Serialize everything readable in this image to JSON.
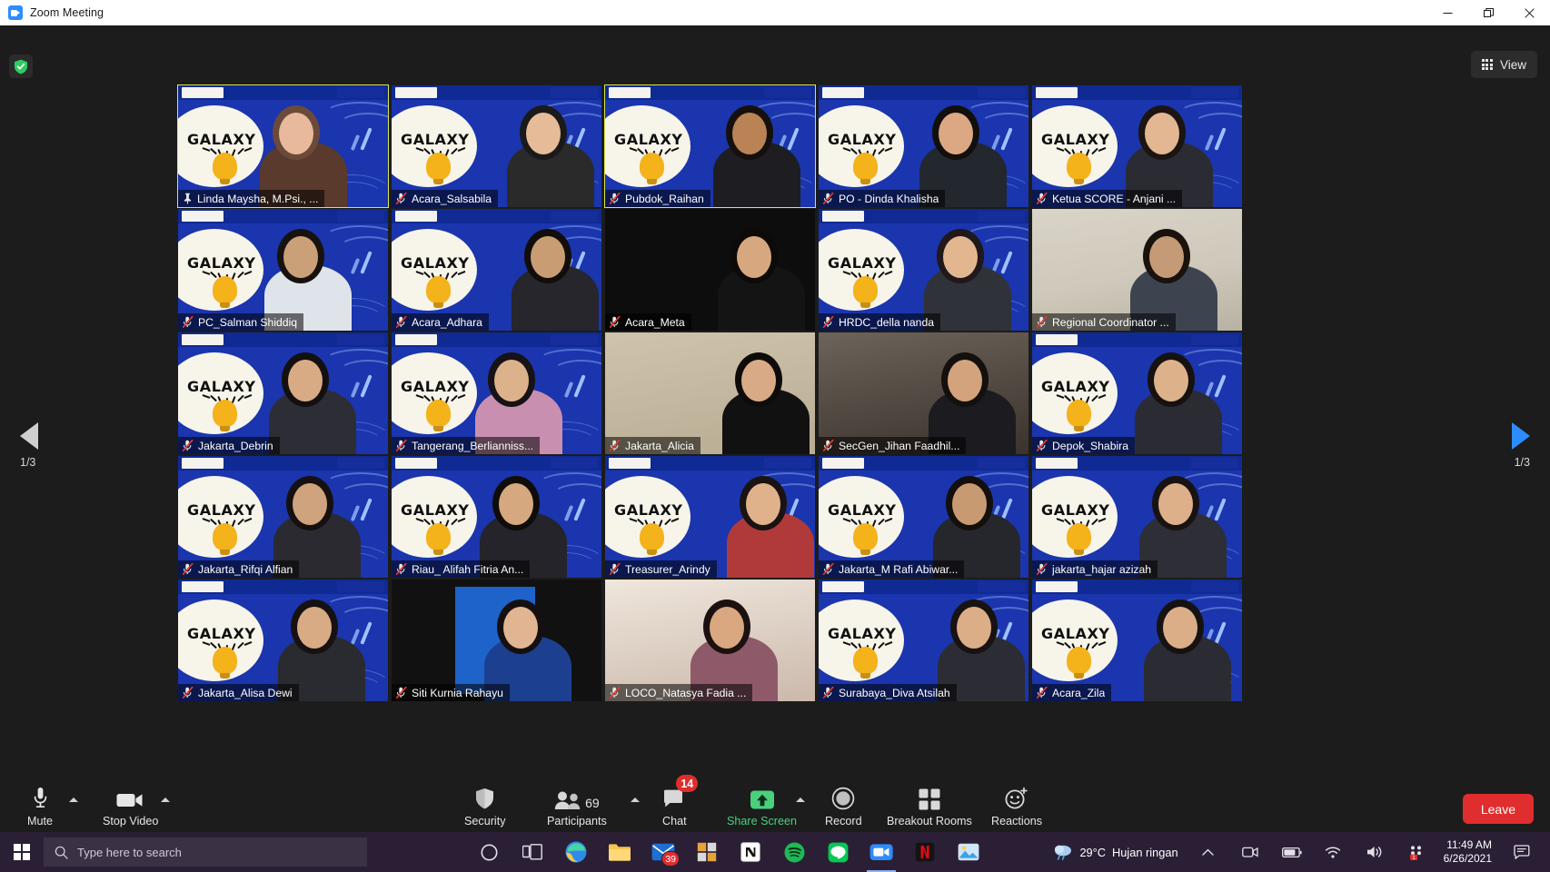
{
  "window": {
    "title": "Zoom Meeting",
    "app_icon": "zoom-icon",
    "minimize_label": "Minimize",
    "restore_label": "Restore",
    "close_label": "Close"
  },
  "topbar": {
    "encryption_icon": "green-shield-check-icon",
    "view_label": "View",
    "view_icon": "grid-icon"
  },
  "gallery": {
    "virtual_bg_text": "GALAXY",
    "page_left": "1/3",
    "page_right": "1/3",
    "prev_icon": "triangle-left-icon",
    "next_icon": "triangle-right-icon",
    "tiles": [
      {
        "name": "Linda Maysha, M.Psi., ...",
        "mic": "muted-pin",
        "active": true,
        "bg": "virtual",
        "skin": "#e8b99a",
        "hair": "#6b4a3a",
        "cloth": "#5a3a2c"
      },
      {
        "name": "Acara_Salsabila",
        "mic": "muted",
        "active": false,
        "bg": "virtual",
        "skin": "#e6bb97",
        "hair": "#1a1a1a",
        "cloth": "#2a2a2a"
      },
      {
        "name": "Pubdok_Raihan",
        "mic": "muted",
        "active": true,
        "bg": "virtual",
        "skin": "#b98355",
        "hair": "#15100c",
        "cloth": "#1d1d22"
      },
      {
        "name": "PO - Dinda Khalisha",
        "mic": "muted",
        "active": false,
        "bg": "virtual",
        "skin": "#dba883",
        "hair": "#120f0d",
        "cloth": "#23272e"
      },
      {
        "name": "Ketua SCORE - Anjani ...",
        "mic": "muted",
        "active": false,
        "bg": "virtual",
        "skin": "#e3b792",
        "hair": "#1b1410",
        "cloth": "#2b2b33"
      },
      {
        "name": "PC_Salman Shiddiq",
        "mic": "muted",
        "active": false,
        "bg": "virtual",
        "skin": "#caa078",
        "hair": "#17120e",
        "cloth": "#dfe3ea"
      },
      {
        "name": "Acara_Adhara",
        "mic": "muted",
        "active": false,
        "bg": "virtual",
        "skin": "#c99d74",
        "hair": "#120d0a",
        "cloth": "#26262c"
      },
      {
        "name": "Acara_Meta",
        "mic": "muted",
        "active": false,
        "bg": "dark",
        "skin": "#d7a87f",
        "hair": "#0d0a08",
        "cloth": "#141414"
      },
      {
        "name": "HRDC_della nanda",
        "mic": "muted",
        "active": false,
        "bg": "virtual",
        "skin": "#e2b78f",
        "hair": "#20181a",
        "cloth": "#30323a"
      },
      {
        "name": "Regional Coordinator ...",
        "mic": "muted",
        "active": false,
        "bg": "room-light",
        "skin": "#c49b76",
        "hair": "#1a120c",
        "cloth": "#3d4450"
      },
      {
        "name": "Jakarta_Debrin",
        "mic": "muted",
        "active": false,
        "bg": "virtual",
        "skin": "#d9ab84",
        "hair": "#141010",
        "cloth": "#2d2d35"
      },
      {
        "name": "Tangerang_Berlianniss...",
        "mic": "muted",
        "active": false,
        "bg": "virtual",
        "skin": "#dcb28d",
        "hair": "#171215",
        "cloth": "#c98fb0"
      },
      {
        "name": "Jakarta_Alicia",
        "mic": "muted",
        "active": false,
        "bg": "room-tan",
        "skin": "#d8ab86",
        "hair": "#0e0c0a",
        "cloth": "#111111"
      },
      {
        "name": "SecGen_Jihan Faadhil...",
        "mic": "muted",
        "active": false,
        "bg": "room-dark",
        "skin": "#d2a37c",
        "hair": "#14100e",
        "cloth": "#1b1b20"
      },
      {
        "name": "Depok_Shabira",
        "mic": "muted",
        "active": false,
        "bg": "virtual",
        "skin": "#ddb28a",
        "hair": "#171110",
        "cloth": "#2b2c33"
      },
      {
        "name": "Jakarta_Rifqi Alfian",
        "mic": "muted",
        "active": false,
        "bg": "virtual",
        "skin": "#cfa37d",
        "hair": "#161010",
        "cloth": "#2a2a30"
      },
      {
        "name": "Riau_ Alifah Fitria An...",
        "mic": "muted",
        "active": false,
        "bg": "virtual",
        "skin": "#d5a87f",
        "hair": "#100c0a",
        "cloth": "#24242a"
      },
      {
        "name": "Treasurer_Arindy",
        "mic": "muted",
        "active": false,
        "bg": "virtual",
        "skin": "#e0b28c",
        "hair": "#1a1312",
        "cloth": "#b03a3a"
      },
      {
        "name": "Jakarta_M Rafi Abiwar...",
        "mic": "muted",
        "active": false,
        "bg": "virtual",
        "skin": "#c89a72",
        "hair": "#130f0c",
        "cloth": "#26262d"
      },
      {
        "name": "jakarta_hajar azizah",
        "mic": "muted",
        "active": false,
        "bg": "virtual",
        "skin": "#ddb08a",
        "hair": "#191212",
        "cloth": "#2e2e36"
      },
      {
        "name": "Jakarta_Alisa Dewi",
        "mic": "muted",
        "active": false,
        "bg": "virtual",
        "skin": "#d8ab84",
        "hair": "#171111",
        "cloth": "#2a2a31"
      },
      {
        "name": "Siti Kurnia Rahayu",
        "mic": "muted",
        "active": false,
        "bg": "photo",
        "skin": "#e2b592",
        "hair": "#151010",
        "cloth": "#1d3f8f"
      },
      {
        "name": "LOCO_Natasya Fadia ...",
        "mic": "muted",
        "active": false,
        "bg": "room-warm",
        "skin": "#d9a780",
        "hair": "#1c1110",
        "cloth": "#8e5a6a"
      },
      {
        "name": "Surabaya_Diva Atsilah",
        "mic": "muted",
        "active": false,
        "bg": "virtual",
        "skin": "#dcae88",
        "hair": "#191212",
        "cloth": "#2c2c34"
      },
      {
        "name": "Acara_Zila",
        "mic": "muted",
        "active": false,
        "bg": "virtual",
        "skin": "#dbae88",
        "hair": "#171212",
        "cloth": "#2b2b33"
      }
    ]
  },
  "toolbar": {
    "mute_label": "Mute",
    "mute_icon": "microphone-icon",
    "stop_video_label": "Stop Video",
    "stop_video_icon": "camera-icon",
    "security_label": "Security",
    "security_icon": "shield-icon",
    "participants_label": "Participants",
    "participants_icon": "people-icon",
    "participants_count": "69",
    "chat_label": "Chat",
    "chat_icon": "chat-bubble-icon",
    "chat_badge": "14",
    "share_label": "Share Screen",
    "share_icon": "up-arrow-icon",
    "record_label": "Record",
    "record_icon": "record-circle-icon",
    "breakout_label": "Breakout Rooms",
    "breakout_icon": "four-squares-icon",
    "reactions_label": "Reactions",
    "reactions_icon": "smiley-plus-icon",
    "leave_label": "Leave",
    "share_color": "#4ad07d",
    "leave_color": "#e02d2d"
  },
  "taskbar": {
    "start_icon": "windows-logo-icon",
    "search_placeholder": "Type here to search",
    "search_icon": "search-icon",
    "cortana_icon": "circle-icon",
    "taskview_icon": "task-view-icon",
    "apps": [
      {
        "name": "edge-icon",
        "badge": ""
      },
      {
        "name": "file-explorer-icon",
        "badge": ""
      },
      {
        "name": "mail-icon",
        "badge": "39"
      },
      {
        "name": "store-icon",
        "badge": ""
      },
      {
        "name": "notion-icon",
        "badge": ""
      },
      {
        "name": "spotify-icon",
        "badge": ""
      },
      {
        "name": "line-icon",
        "badge": ""
      },
      {
        "name": "zoom-icon",
        "badge": ""
      },
      {
        "name": "netflix-icon",
        "badge": ""
      },
      {
        "name": "photos-icon",
        "badge": ""
      }
    ],
    "weather_temp": "29°C",
    "weather_desc": "Hujan ringan",
    "weather_icon": "rain-cloud-icon",
    "tray_overflow_icon": "chevron-up-icon",
    "tray_icons": [
      "webcam-icon",
      "battery-icon",
      "wifi-icon",
      "volume-icon",
      "notification-dots-icon"
    ],
    "time": "11:49 AM",
    "date": "6/26/2021",
    "action_center_icon": "action-center-icon"
  }
}
